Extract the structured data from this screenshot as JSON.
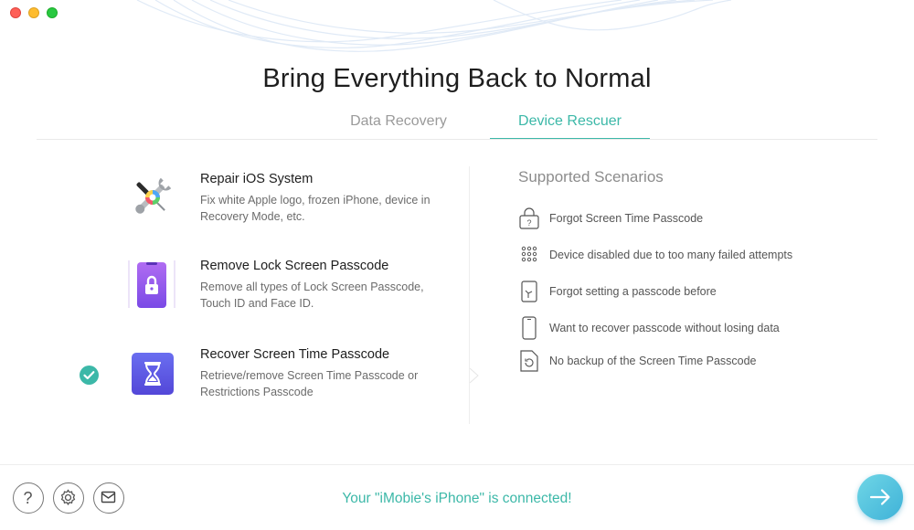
{
  "window": {
    "title": "Bring Everything Back to Normal"
  },
  "tabs": [
    {
      "label": "Data Recovery",
      "active": false
    },
    {
      "label": "Device Rescuer",
      "active": true
    }
  ],
  "options": [
    {
      "icon": "repair-tools-icon",
      "title": "Repair iOS System",
      "description": "Fix white Apple logo, frozen iPhone, device in Recovery Mode, etc.",
      "selected": false
    },
    {
      "icon": "lock-phone-icon",
      "title": "Remove Lock Screen Passcode",
      "description": "Remove all types of Lock Screen Passcode, Touch ID and Face ID.",
      "selected": false
    },
    {
      "icon": "hourglass-icon",
      "title": "Recover Screen Time Passcode",
      "description": "Retrieve/remove Screen Time Passcode or Restrictions Passcode",
      "selected": true
    }
  ],
  "scenarios": {
    "heading": "Supported Scenarios",
    "items": [
      {
        "icon": "lock-question-icon",
        "text": "Forgot Screen Time Passcode"
      },
      {
        "icon": "keypad-dots-icon",
        "text": "Device disabled due to too many failed attempts"
      },
      {
        "icon": "phone-hand-icon",
        "text": "Forgot setting a passcode before"
      },
      {
        "icon": "phone-outline-icon",
        "text": "Want to recover passcode without losing data"
      },
      {
        "icon": "restore-file-icon",
        "text": "No backup of the Screen Time Passcode"
      }
    ]
  },
  "footer": {
    "status": "Your \"iMobie's iPhone\" is connected!",
    "help_icon": "help-icon",
    "settings_icon": "gear-icon",
    "mail_icon": "mail-icon",
    "next_icon": "arrow-right-icon"
  },
  "colors": {
    "accent": "#3cb8a8",
    "next_button": "#4dbfe0"
  }
}
